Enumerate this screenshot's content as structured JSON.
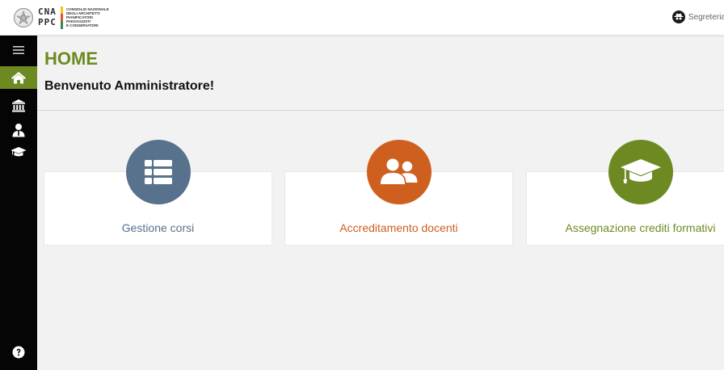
{
  "header": {
    "logo_letters_top": "CNA",
    "logo_letters_bottom": "PPC",
    "logo_lines": [
      "Consiglio Nazionale",
      "degli Architetti",
      "Pianificatori",
      "Paesaggisti",
      "e Conservatori"
    ],
    "user_name": "Segreteria"
  },
  "sidebar": {
    "items": [
      {
        "icon": "menu-icon"
      },
      {
        "icon": "home-icon",
        "active": true
      },
      {
        "icon": "institution-icon"
      },
      {
        "icon": "teacher-icon"
      },
      {
        "icon": "graduation-cap-icon"
      },
      {
        "icon": "help-icon"
      }
    ]
  },
  "main": {
    "title": "HOME",
    "welcome": "Benvenuto Amministratore!",
    "cards": [
      {
        "label": "Gestione corsi",
        "color": "#58718c",
        "icon": "list-icon"
      },
      {
        "label": "Accreditamento docenti",
        "color": "#cf5f1f",
        "icon": "users-icon"
      },
      {
        "label": "Assegnazione crediti formativi",
        "color": "#6d8a22",
        "icon": "graduation-cap-icon"
      }
    ]
  },
  "colors": {
    "accent": "#6d8a22",
    "sidebar_bg": "#050505",
    "background": "#f2f2f2"
  }
}
